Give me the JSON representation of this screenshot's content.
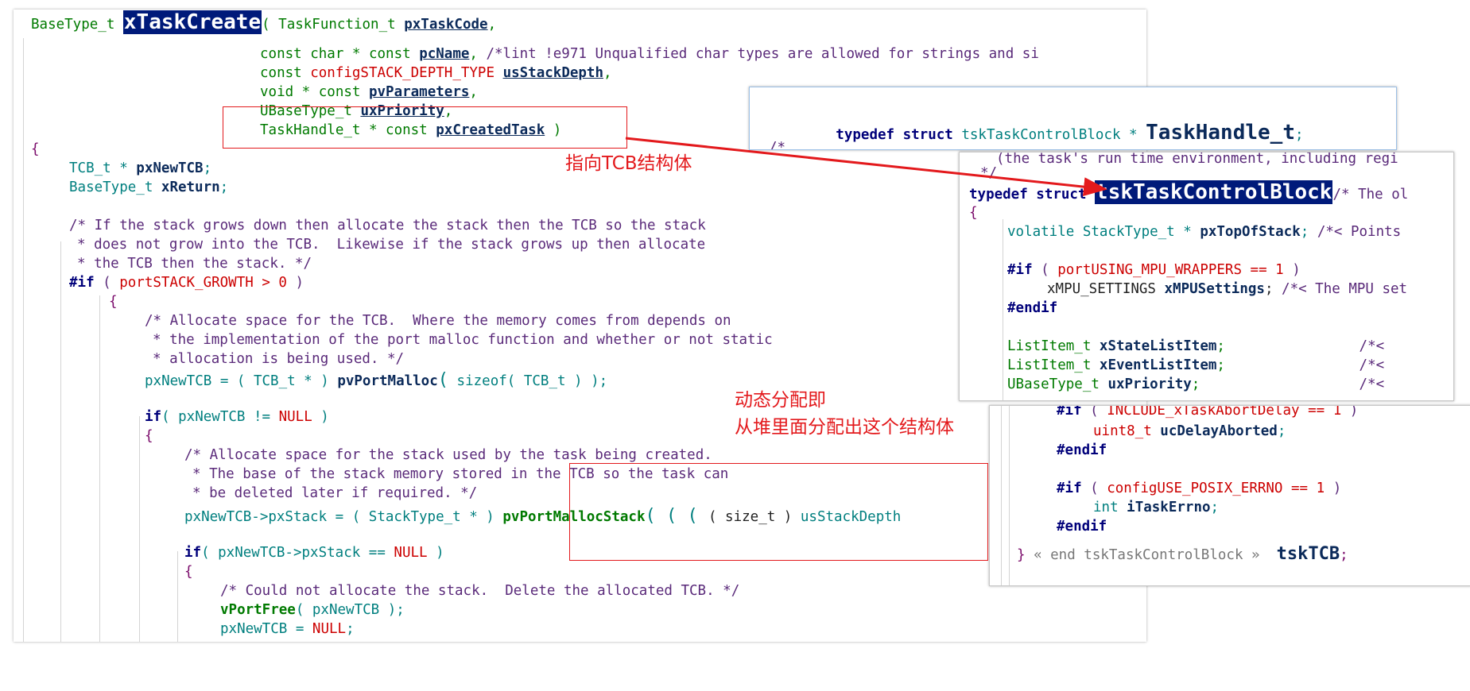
{
  "main_editor": {
    "lines": [
      "BaseType_t xTaskCreate( TaskFunction_t pxTaskCode,",
      "const char * const pcName, /*lint !e971 Unqualified char types are allowed for strings and si",
      "const configSTACK_DEPTH_TYPE usStackDepth,",
      "void * const pvParameters,",
      "UBaseType_t uxPriority,",
      "TaskHandle_t * const pxCreatedTask )",
      "{",
      "TCB_t * pxNewTCB;",
      "BaseType_t xReturn;",
      "/* If the stack grows down then allocate the stack then the TCB so the stack",
      "* does not grow into the TCB.  Likewise if the stack grows up then allocate",
      "* the TCB then the stack. */",
      "#if ( portSTACK_GROWTH > 0 )",
      "{",
      "/* Allocate space for the TCB.  Where the memory comes from depends on",
      "* the implementation of the port malloc function and whether or not static",
      "* allocation is being used. */",
      "pxNewTCB = ( TCB_t * ) pvPortMalloc( sizeof( TCB_t ) );",
      "if( pxNewTCB != NULL )",
      "{",
      "/* Allocate space for the stack used by the task being created.",
      "* The base of the stack memory stored in the TCB so the task can",
      "* be deleted later if required. */",
      "pxNewTCB->pxStack = ( StackType_t * ) pvPortMallocStack( ( ( ( size_t ) usStackDepth",
      "if( pxNewTCB->pxStack == NULL )",
      "{",
      "/* Could not allocate the stack.  Delete the allocated TCB. */",
      "vPortFree( pxNewTCB );",
      "pxNewTCB = NULL;"
    ]
  },
  "typedef_popup": {
    "line1": "typedef struct tskTaskControlBlock * TaskHandle_t;",
    "line2": "/*"
  },
  "struct_popup": {
    "lines": [
      "(the task's run time environment, including regi",
      "*/",
      "typedef struct tskTaskControlBlock/* The ol",
      "{",
      "volatile StackType_t * pxTopOfStack; /*< Points",
      "#if ( portUSING_MPU_WRAPPERS == 1 )",
      "xMPU_SETTINGS xMPUSettings; /*< The MPU set",
      "#endif",
      "ListItem_t xStateListItem;                /*<",
      "ListItem_t xEventListItem;                /*<",
      "UBaseType_t uxPriority;                   /*<"
    ]
  },
  "tcb_popup": {
    "lines": [
      "#if ( INCLUDE_xTaskAbortDelay == 1 )",
      "uint8_t ucDelayAborted;",
      "#endif",
      "#if ( configUSE_POSIX_ERRNO == 1 )",
      "int iTaskErrno;",
      "#endif",
      "} « end tskTaskControlBlock »  tskTCB;"
    ]
  },
  "annotations": {
    "pointer_label": "指向TCB结构体",
    "dynamic_line1": "动态分配即",
    "dynamic_line2": "从堆里面分配出这个结构体"
  },
  "colors": {
    "annotation_red": "#e3191c",
    "highlight_bg": "#001a7a",
    "keyword": "#00007a",
    "type_teal": "#007f7f",
    "green": "#007a00",
    "comment_purple": "#5a2a7a"
  }
}
